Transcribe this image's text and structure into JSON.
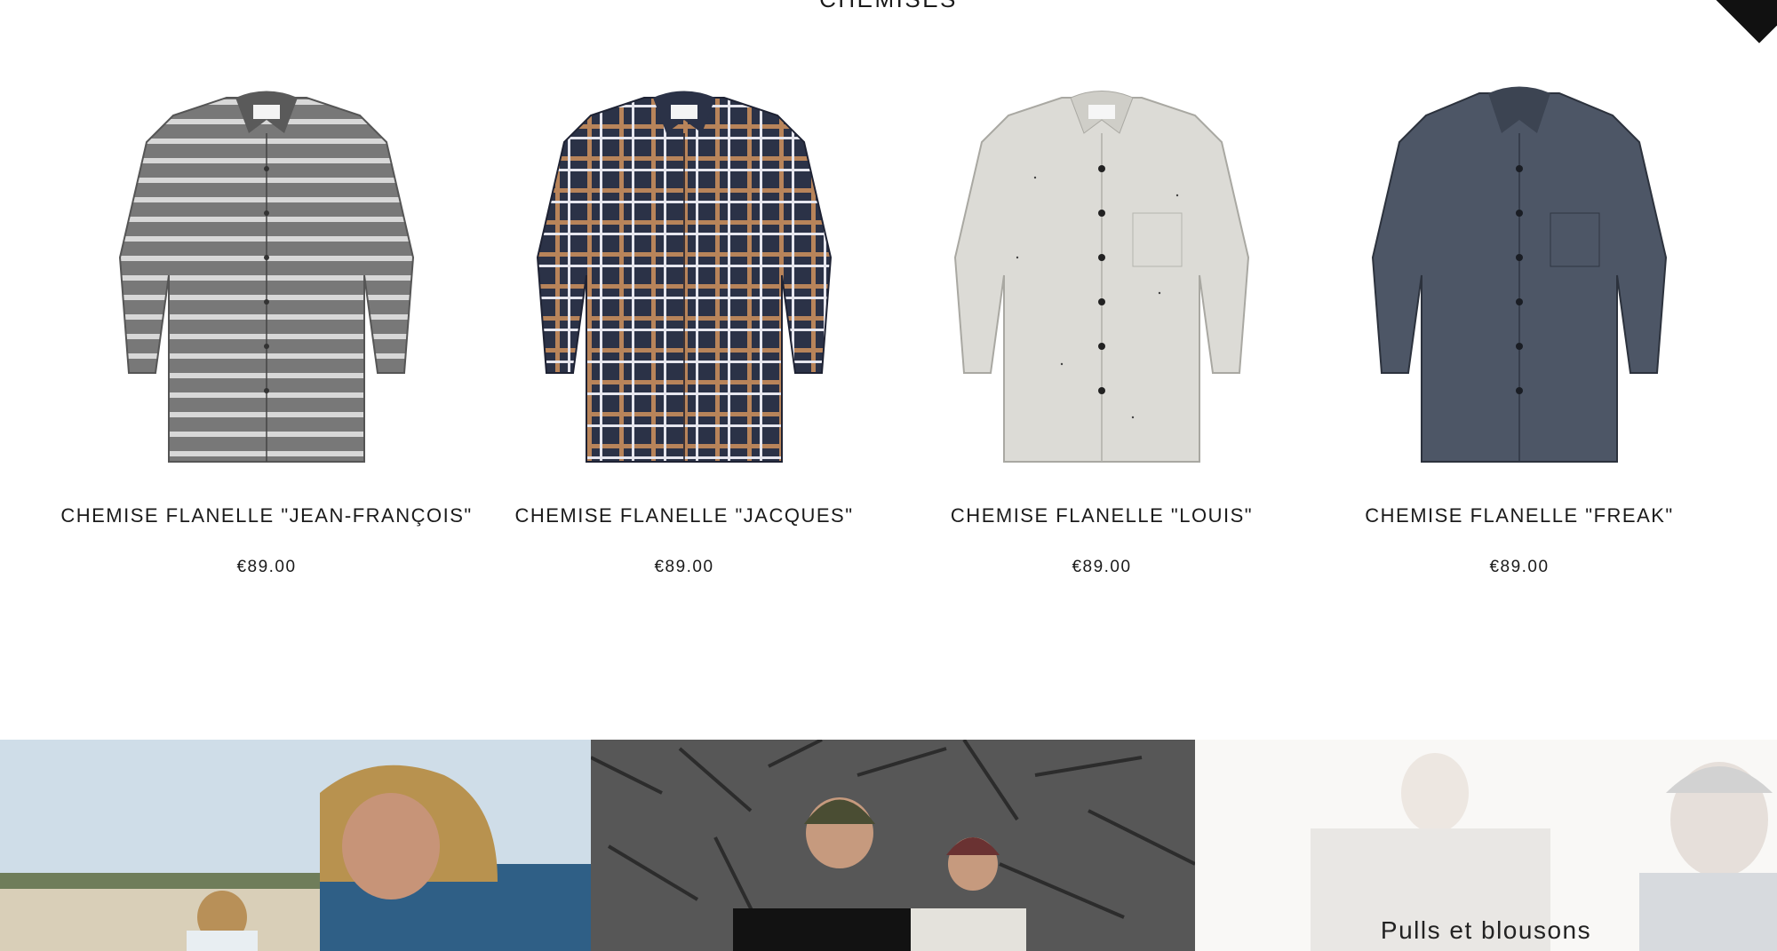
{
  "section": {
    "title": "CHEMISES"
  },
  "products": [
    {
      "title": "CHEMISE FLANELLE \"JEAN-FRANÇOIS\"",
      "price": "€89.00",
      "image_icon": "grey-striped-shirt-image"
    },
    {
      "title": "CHEMISE FLANELLE \"JACQUES\"",
      "price": "€89.00",
      "image_icon": "navy-plaid-shirt-image"
    },
    {
      "title": "CHEMISE FLANELLE \"LOUIS\"",
      "price": "€89.00",
      "image_icon": "speckled-white-shirt-image"
    },
    {
      "title": "CHEMISE FLANELLE \"FREAK\"",
      "price": "€89.00",
      "image_icon": "blue-grey-shirt-image"
    }
  ],
  "collections": [
    {
      "label": "",
      "image_icon": "beach-hoodie-photo"
    },
    {
      "label": "",
      "image_icon": "wood-wall-beanie-photo"
    },
    {
      "label": "Pulls et blousons",
      "image_icon": "dunes-sweaters-photo"
    }
  ],
  "colors": {
    "text": "#1a1a1a",
    "background": "#ffffff",
    "striped_shirt": "#7a7a7a",
    "plaid_shirt": "#2b3247",
    "plaid_accent": "#b8845a",
    "speckled_shirt": "#dcdbd6",
    "blue_grey_shirt": "#4d5666"
  }
}
